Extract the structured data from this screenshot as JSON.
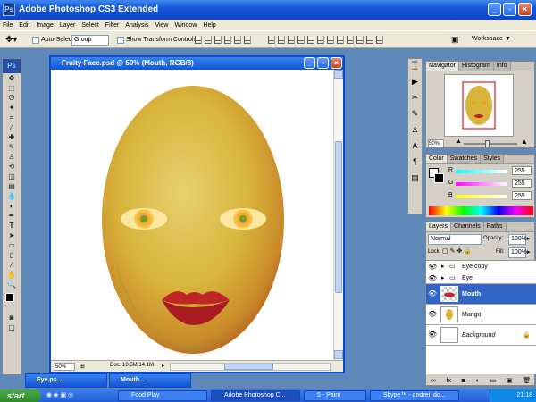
{
  "app": {
    "title": "Adobe Photoshop CS3 Extended",
    "logo": "Ps"
  },
  "menu": [
    "File",
    "Edit",
    "Image",
    "Layer",
    "Select",
    "Filter",
    "Analysis",
    "View",
    "Window",
    "Help"
  ],
  "options": {
    "auto_select_label": "Auto-Select:",
    "auto_select_value": "Group",
    "transform_label": "Show Transform Controls",
    "workspace": "Workspace ▼"
  },
  "document": {
    "title": "Fruity Face.psd @ 50% (Mouth, RGB/8)",
    "zoom": "50%",
    "doc_info": "Doc: 10.5M/14.1M"
  },
  "navigator": {
    "tabs": [
      "Navigator",
      "Histogram",
      "Info"
    ],
    "zoom": "50%"
  },
  "color": {
    "tabs": [
      "Color",
      "Swatches",
      "Styles"
    ],
    "r_label": "R",
    "g_label": "G",
    "b_label": "B",
    "r": "255",
    "g": "255",
    "b": "255"
  },
  "layers": {
    "tabs": [
      "Layers",
      "Channels",
      "Paths"
    ],
    "blend_mode": "Normal",
    "opacity_label": "Opacity:",
    "opacity": "100%",
    "lock_label": "Lock:",
    "fill_label": "Fill:",
    "fill": "100%",
    "items": [
      {
        "name": "Eye copy",
        "type": "group"
      },
      {
        "name": "Eye",
        "type": "group"
      },
      {
        "name": "Mouth",
        "type": "layer",
        "selected": true
      },
      {
        "name": "Mango",
        "type": "layer"
      },
      {
        "name": "Background",
        "type": "layer"
      }
    ]
  },
  "minimized": [
    {
      "title": "Eye.ps..."
    },
    {
      "title": "Mouth..."
    }
  ],
  "taskbar": {
    "start": "start",
    "tasks": [
      "Food Play",
      "Adobe Photoshop C...",
      "5 - Paint",
      "Skype™ - andrei_do..."
    ],
    "clock": "21:18"
  },
  "colors": {
    "accent": "#1657d8",
    "selection": "#3165c6",
    "mango": "#d9b23a"
  }
}
